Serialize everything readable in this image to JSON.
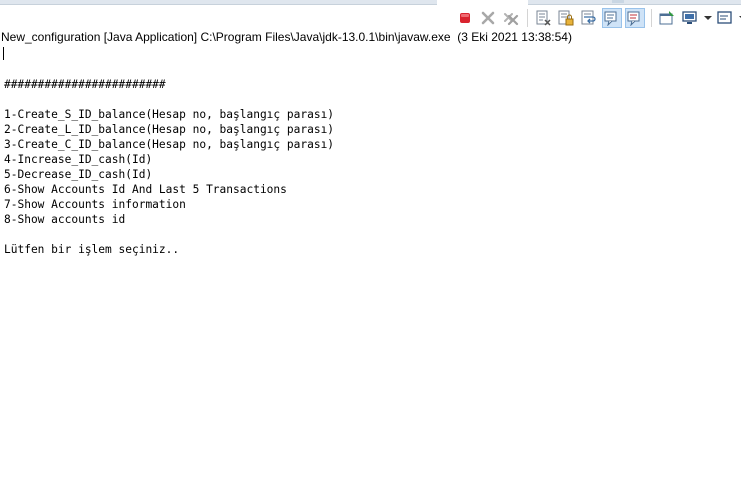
{
  "toolbar": {
    "buttons": [
      {
        "name": "terminate-icon",
        "color": "#d9232e"
      },
      {
        "name": "remove-launch-icon",
        "color": "#a8a8a8"
      },
      {
        "name": "remove-all-terminated-icon",
        "color": "#a8a8a8"
      },
      {
        "name": "clear-console-icon"
      },
      {
        "name": "scroll-lock-icon"
      },
      {
        "name": "word-wrap-icon"
      },
      {
        "name": "show-console-on-stdout-icon",
        "pressed": true
      },
      {
        "name": "show-console-on-stderr-icon",
        "pressed": true
      },
      {
        "name": "pin-console-icon"
      },
      {
        "name": "display-selected-console-icon"
      },
      {
        "name": "open-console-icon"
      }
    ]
  },
  "console": {
    "title": "New_configuration [Java Application] C:\\Program Files\\Java\\jdk-13.0.1\\bin\\javaw.exe  (3 Eki 2021 13:38:54)",
    "lines": [
      "",
      "########################",
      "",
      "1-Create_S_ID_balance(Hesap no, başlangıç parası)",
      "2-Create_L_ID_balance(Hesap no, başlangıç parası)",
      "3-Create_C_ID_balance(Hesap no, başlangıç parası)",
      "4-Increase_ID_cash(Id)",
      "5-Decrease_ID_cash(Id)",
      "6-Show Accounts Id And Last 5 Transactions",
      "7-Show Accounts information",
      "8-Show accounts id",
      "",
      "Lütfen bir işlem seçiniz.."
    ]
  }
}
